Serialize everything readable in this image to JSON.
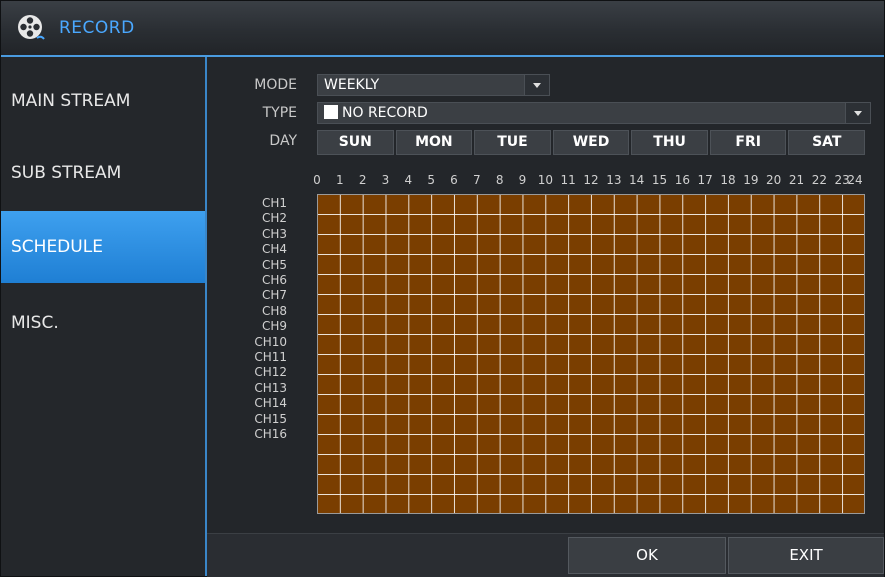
{
  "window": {
    "title": "RECORD",
    "icon": "film-reel-icon"
  },
  "sidebar": {
    "items": [
      {
        "label": "MAIN STREAM",
        "active": false
      },
      {
        "label": "SUB STREAM",
        "active": false
      },
      {
        "label": "SCHEDULE",
        "active": true
      },
      {
        "label": "MISC.",
        "active": false
      }
    ]
  },
  "form": {
    "mode_label": "MODE",
    "mode_value": "WEEKLY",
    "type_label": "TYPE",
    "type_value": "NO RECORD",
    "day_label": "DAY",
    "days": [
      "SUN",
      "MON",
      "TUE",
      "WED",
      "THU",
      "FRI",
      "SAT"
    ]
  },
  "schedule": {
    "hours": [
      "0",
      "1",
      "2",
      "3",
      "4",
      "5",
      "6",
      "7",
      "8",
      "9",
      "10",
      "11",
      "12",
      "13",
      "14",
      "15",
      "16",
      "17",
      "18",
      "19",
      "20",
      "21",
      "22",
      "23",
      "24"
    ],
    "channels": [
      "CH1",
      "CH2",
      "CH3",
      "CH4",
      "CH5",
      "CH6",
      "CH7",
      "CH8",
      "CH9",
      "CH10",
      "CH11",
      "CH12",
      "CH13",
      "CH14",
      "CH15",
      "CH16"
    ],
    "cell_color": "#7a3e00"
  },
  "footer": {
    "ok_label": "OK",
    "exit_label": "EXIT"
  },
  "colors": {
    "accent": "#3ea0ef",
    "title_text": "#4aa8ff"
  }
}
